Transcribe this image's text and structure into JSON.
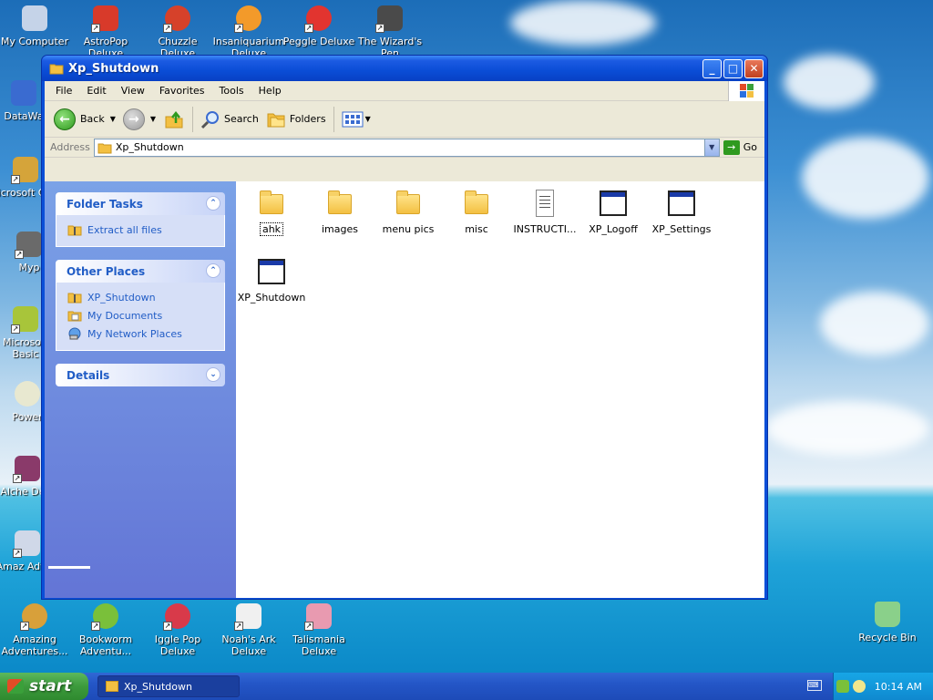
{
  "desktop": {
    "icons": [
      {
        "label": "My Computer",
        "color": "#c5d3e8"
      },
      {
        "label": "AstroPop Deluxe",
        "color": "#d83a2a"
      },
      {
        "label": "Chuzzle Deluxe",
        "color": "#d6412a"
      },
      {
        "label": "Insaniquarium Deluxe",
        "color": "#f39a2a"
      },
      {
        "label": "Peggle Deluxe",
        "color": "#e2342f"
      },
      {
        "label": "The Wizard's Pen",
        "color": "#4a4a4a"
      },
      {
        "label": "DataWa",
        "color": "#3a6bd0"
      },
      {
        "label": "Microsoft C++",
        "color": "#d5a43a"
      },
      {
        "label": "Myp",
        "color": "#6a6a6a"
      },
      {
        "label": "Microsoft Basic",
        "color": "#a8c53a"
      },
      {
        "label": "Power",
        "color": "#e8e8d0"
      },
      {
        "label": "Alche Delu",
        "color": "#8a3a6a"
      },
      {
        "label": "Amaz Adven",
        "color": "#d0d8e8"
      },
      {
        "label": "Amazing Adventures...",
        "color": "#d8a03a"
      },
      {
        "label": "Bookworm Adventu...",
        "color": "#7ac03a"
      },
      {
        "label": "Iggle Pop Deluxe",
        "color": "#d83a4a"
      },
      {
        "label": "Noah's Ark Deluxe",
        "color": "#f0f0f0"
      },
      {
        "label": "Talismania Deluxe",
        "color": "#e89ab0"
      },
      {
        "label": "Recycle Bin",
        "color": "#8ad08a"
      }
    ]
  },
  "window": {
    "title": "Xp_Shutdown",
    "buttons": {
      "minimize": "_",
      "maximize": "□",
      "close": "✕"
    },
    "menu": [
      "File",
      "Edit",
      "View",
      "Favorites",
      "Tools",
      "Help"
    ],
    "toolbar": {
      "back": "Back",
      "search": "Search",
      "folders": "Folders"
    },
    "address": {
      "label": "Address",
      "value": "Xp_Shutdown",
      "go": "Go"
    },
    "panels": {
      "folder_tasks": {
        "title": "Folder Tasks",
        "items": [
          "Extract all files"
        ]
      },
      "other_places": {
        "title": "Other Places",
        "items": [
          "XP_Shutdown",
          "My Documents",
          "My Network Places"
        ]
      },
      "details": {
        "title": "Details"
      }
    },
    "files": [
      {
        "name": "ahk",
        "type": "folder"
      },
      {
        "name": "images",
        "type": "folder"
      },
      {
        "name": "menu pics",
        "type": "folder"
      },
      {
        "name": "misc",
        "type": "folder"
      },
      {
        "name": "INSTRUCTI...",
        "type": "text"
      },
      {
        "name": "XP_Logoff",
        "type": "app"
      },
      {
        "name": "XP_Settings",
        "type": "app"
      },
      {
        "name": "XP_Shutdown",
        "type": "app"
      }
    ]
  },
  "taskbar": {
    "start": "start",
    "task": "Xp_Shutdown",
    "clock": "10:14 AM"
  }
}
